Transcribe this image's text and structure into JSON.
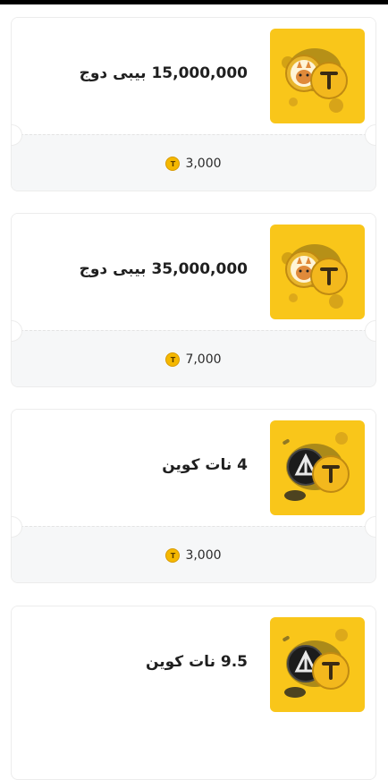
{
  "items": [
    {
      "title": "15,000,000 بیبی دوج",
      "price": "3,000",
      "thumb_icon": "baby-doge-coin-art"
    },
    {
      "title": "35,000,000 بیبی دوج",
      "price": "7,000",
      "thumb_icon": "baby-doge-coin-art"
    },
    {
      "title": "4 نات کوین",
      "price": "3,000",
      "thumb_icon": "notcoin-art"
    },
    {
      "title": "9.5 نات کوین",
      "price": "",
      "thumb_icon": "notcoin-art"
    }
  ],
  "currency_icon": "tetherland-coin-icon",
  "colors": {
    "accent": "#f9c61a",
    "card_border": "#ececec",
    "price_bg": "#f6f7f8"
  }
}
